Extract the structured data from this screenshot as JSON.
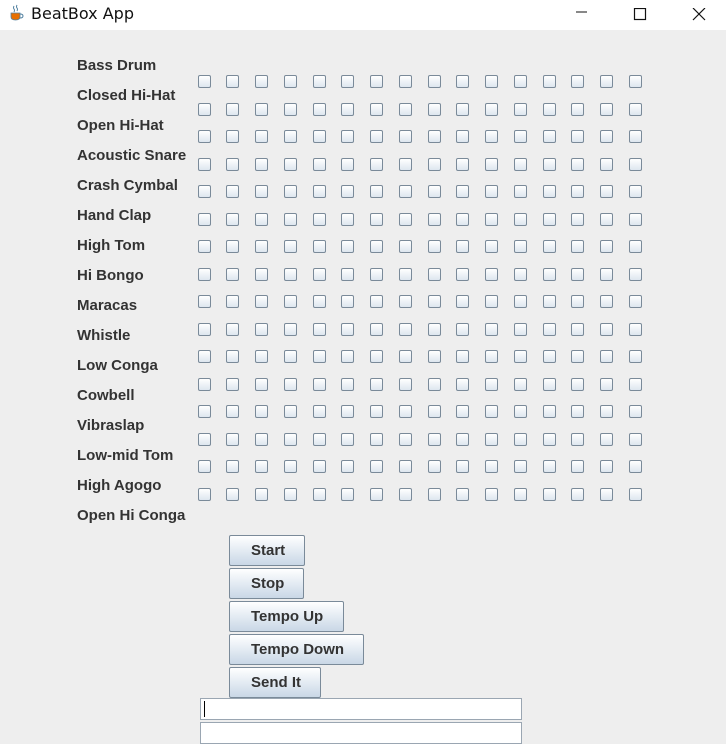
{
  "window": {
    "title": "BeatBox App",
    "icon": "java-cup-icon",
    "controls": [
      "minimize-icon",
      "maximize-icon",
      "close-icon"
    ]
  },
  "instruments": [
    "Bass Drum",
    "Closed Hi-Hat",
    "Open Hi-Hat",
    "Acoustic Snare",
    "Crash Cymbal",
    "Hand Clap",
    "High Tom",
    "Hi Bongo",
    "Maracas",
    "Whistle",
    "Low Conga",
    "Cowbell",
    "Vibraslap",
    "Low-mid Tom",
    "High Agogo",
    "Open Hi Conga"
  ],
  "grid": {
    "checked_cells": []
  },
  "buttons": {
    "start": "Start",
    "stop": "Stop",
    "tempo_up": "Tempo Up",
    "tempo_down": "Tempo Down",
    "send": "Send It"
  },
  "message_field": {
    "value": ""
  },
  "incoming_list": {
    "items": []
  }
}
